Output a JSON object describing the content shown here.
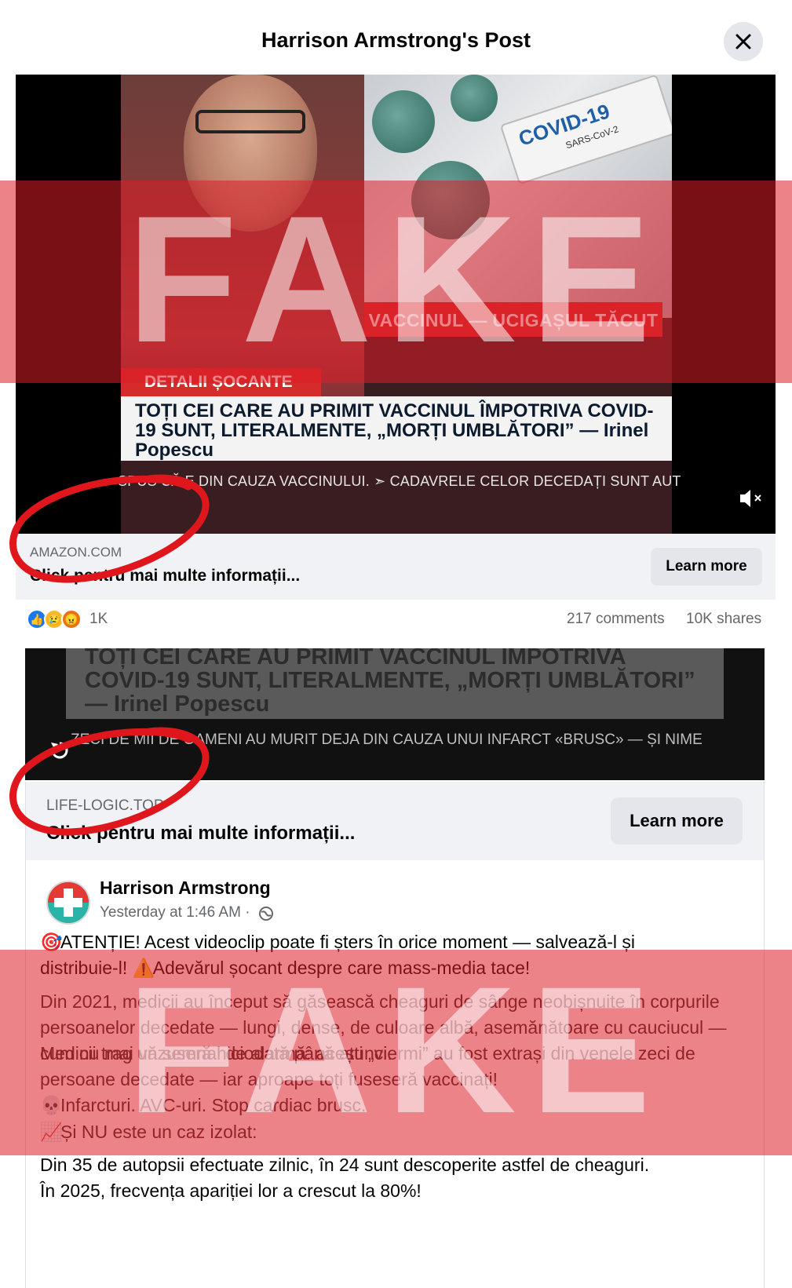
{
  "header": {
    "title": "Harrison Armstrong's Post"
  },
  "video1": {
    "overlay_bar": "VACCINUL — UCIGAȘUL TĂCUT",
    "tube_label": "COVID-19",
    "tube_sub": "SARS-CoV-2",
    "tag": "DETALII ȘOCANTE",
    "headline": "TOȚI CEI CARE AU PRIMIT VACCINUL ÎMPOTRIVA COVID-19 SUNT, LITERALMENTE, „MORȚI UMBLĂTORI” — Irinel Popescu",
    "ticker": "SPUS CĂ E DIN CAUZA VACCINULUI. ➣ CADAVRELE CELOR DECEDAȚI SUNT AUT"
  },
  "link1": {
    "domain": "AMAZON.COM",
    "cta": "Click pentru mai multe informații...",
    "button": "Learn more"
  },
  "reactions": {
    "count": "1K",
    "comments": "217 comments",
    "shares": "10K shares"
  },
  "video2": {
    "headline": "TOȚI CEI CARE AU PRIMIT VACCINUL ÎMPOTRIVA COVID-19 SUNT, LITERALMENTE, „MORȚI UMBLĂTORI” — Irinel Popescu",
    "ticker": "ZECI DE MII DE OAMENI AU MURIT DEJA DIN CAUZA UNUI INFARCT «BRUSC» — ȘI NIME"
  },
  "link2": {
    "domain": "LIFE-LOGIC.TOP",
    "cta": "Click pentru mai multe informații...",
    "button": "Learn more"
  },
  "post": {
    "author": "Harrison Armstrong",
    "timestamp": "Yesterday at 1:46 AM ·",
    "line1": "ATENȚIE! Acest videoclip poate fi șters în orice moment — salvează-l și",
    "line2a": "distribuie-l!",
    "line2b": "Adevărul șocant despre care mass-media tace!",
    "para1": "Din 2021, medicii au început să găsească cheaguri de sânge neobișnuite în corpurile persoanelor decedate — lungi, dense, de culoare albă, asemănătoare cu cauciucul — cum nu mai văzuseră niciodată până atunci.",
    "para2": "Medicii trag un semnal de alarmă: acești „viermi” au fost extrași din venele zeci de persoane decedate — iar aproape toți fuseseră vaccinați!",
    "line_skull": "Infarcturi. AVC-uri. Stop cardiac brusc.",
    "line_chart": "Și NU este un caz izolat:",
    "para3": "Din 35 de autopsii efectuate zilnic, în 24 sunt descoperite astfel de cheaguri.",
    "para4": "În 2025, frecvența apariției lor a crescut la 80%!"
  },
  "overlay": {
    "stamp": "FAKE"
  },
  "colors": {
    "fake_band": "#dc1e28",
    "fb_grey": "#65676b",
    "button_bg": "#e4e6eb",
    "news_red": "#d62b2b"
  },
  "icons": [
    "close-icon",
    "mute-icon",
    "replay-icon",
    "globe-icon",
    "like-reaction-icon",
    "sad-reaction-icon",
    "angry-reaction-icon",
    "target-emoji-icon",
    "warning-emoji-icon",
    "skull-emoji-icon",
    "chart-emoji-icon",
    "medical-cross-icon"
  ]
}
